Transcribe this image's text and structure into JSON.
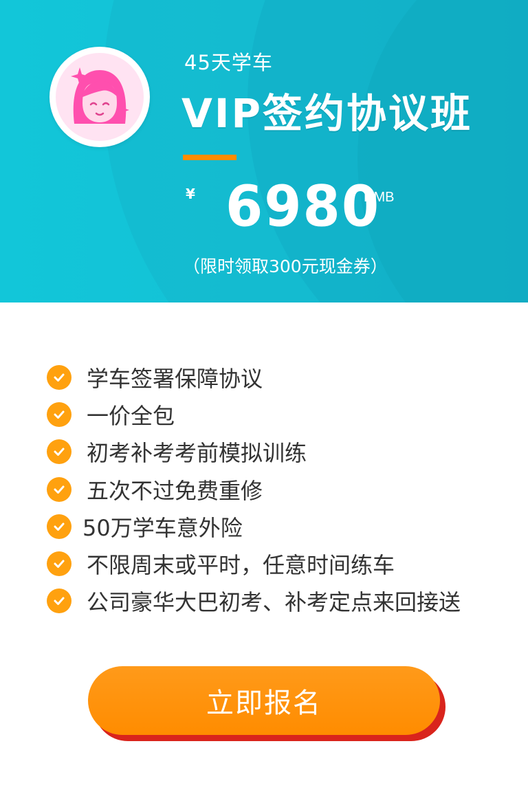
{
  "header": {
    "subtitle": "45天学车",
    "title": "VIP签约协议班",
    "price_symbol": "¥",
    "price": "6980",
    "currency": "RMB",
    "coupon_note": "（限时领取300元现金券）"
  },
  "features": [
    "学车签署保障协议",
    "一价全包",
    "初考补考考前模拟训练",
    "五次不过免费重修",
    "50万学车意外险",
    "不限周末或平时，任意时间练车",
    "公司豪华大巴初考、补考定点来回接送"
  ],
  "cta": {
    "label": "立即报名"
  },
  "colors": {
    "header_bg": "#14c2d6",
    "accent_orange": "#ff8c00",
    "check_orange": "#ffa10f",
    "cta_shadow": "#d9241c",
    "avatar_pink": "#ff5fb5"
  },
  "icons": {
    "avatar": "girl-face-icon",
    "check": "check-circle-icon"
  }
}
